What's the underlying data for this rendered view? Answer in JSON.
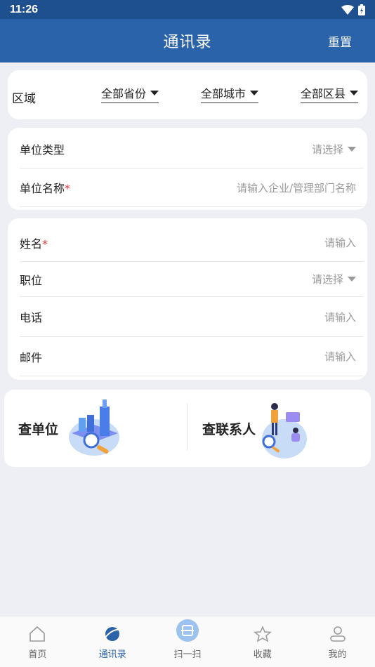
{
  "status": {
    "time": "11:26"
  },
  "header": {
    "title": "通讯录",
    "reset": "重置"
  },
  "region": {
    "label": "区域",
    "province": "全部省份",
    "city": "全部城市",
    "district": "全部区县"
  },
  "unit": {
    "type_label": "单位类型",
    "type_value": "请选择",
    "name_label": "单位名称",
    "name_placeholder": "请输入企业/管理部门名称"
  },
  "person": {
    "name_label": "姓名",
    "name_placeholder": "请输入",
    "position_label": "职位",
    "position_value": "请选择",
    "phone_label": "电话",
    "phone_placeholder": "请输入",
    "email_label": "邮件",
    "email_placeholder": "请输入"
  },
  "quick": {
    "unit_label": "查单位",
    "contact_label": "查联系人"
  },
  "tabs": [
    {
      "label": "首页",
      "icon": "home-icon"
    },
    {
      "label": "通讯录",
      "icon": "planet-icon"
    },
    {
      "label": "扫一扫",
      "icon": "scan-icon"
    },
    {
      "label": "收藏",
      "icon": "star-icon"
    },
    {
      "label": "我的",
      "icon": "user-icon"
    }
  ],
  "colors": {
    "primary": "#2b63aa",
    "statusbar": "#1e4f8f",
    "required": "#ee3333"
  }
}
